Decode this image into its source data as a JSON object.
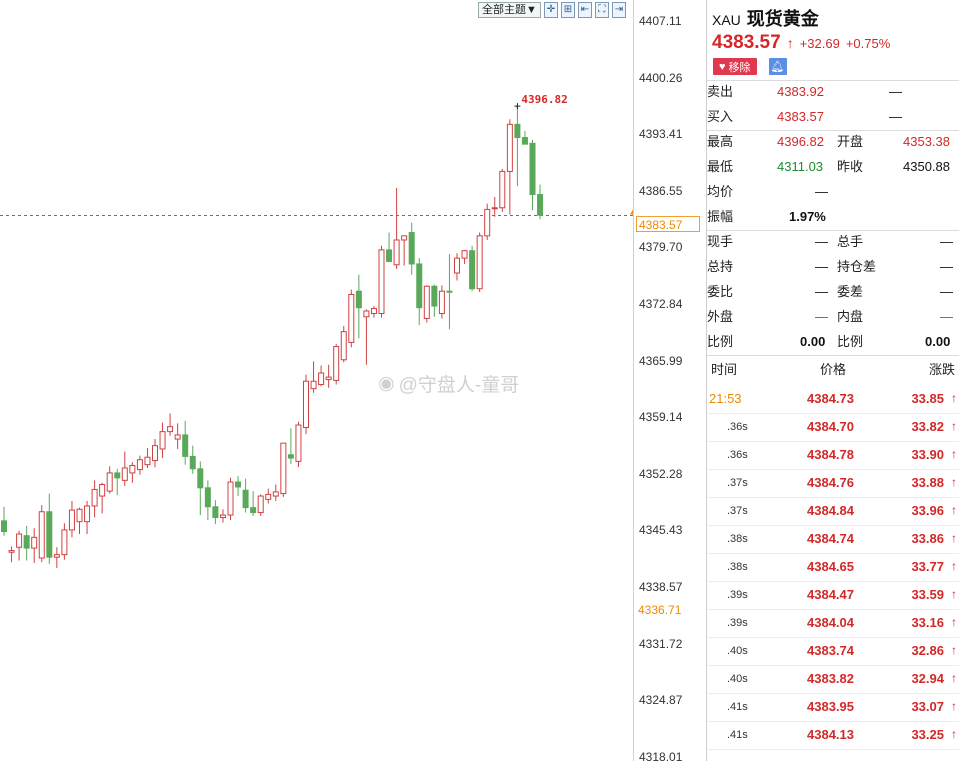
{
  "toolbar": {
    "theme_label": "全部主题▼"
  },
  "watermark": {
    "text": "@守盘人-童哥"
  },
  "axis": {
    "ticks": [
      "4407.11",
      "4400.26",
      "4393.41",
      "4386.55",
      "4379.70",
      "4372.84",
      "4365.99",
      "4359.14",
      "4352.28",
      "4345.43",
      "4338.57",
      "4331.72",
      "4324.87",
      "4318.01"
    ],
    "current_price": "4383.57",
    "low_marker": "4336.71"
  },
  "chart_data": {
    "type": "candlestick",
    "high_annotation": "4396.82",
    "current_line": 4383.57,
    "ylim": [
      4318.01,
      4407.11
    ],
    "candles": [
      {
        "o": 4346.6,
        "h": 4348.3,
        "l": 4344.8,
        "c": 4345.3
      },
      {
        "o": 4342.8,
        "h": 4343.5,
        "l": 4341.6,
        "c": 4343.0
      },
      {
        "o": 4343.4,
        "h": 4345.4,
        "l": 4341.8,
        "c": 4345.0
      },
      {
        "o": 4344.8,
        "h": 4346.0,
        "l": 4341.8,
        "c": 4343.3
      },
      {
        "o": 4343.3,
        "h": 4345.7,
        "l": 4341.5,
        "c": 4344.6
      },
      {
        "o": 4342.1,
        "h": 4348.5,
        "l": 4341.6,
        "c": 4347.7
      },
      {
        "o": 4347.7,
        "h": 4349.9,
        "l": 4341.4,
        "c": 4342.2
      },
      {
        "o": 4342.2,
        "h": 4343.4,
        "l": 4340.9,
        "c": 4342.5
      },
      {
        "o": 4342.5,
        "h": 4346.3,
        "l": 4341.9,
        "c": 4345.5
      },
      {
        "o": 4345.5,
        "h": 4349.0,
        "l": 4344.6,
        "c": 4347.9
      },
      {
        "o": 4346.5,
        "h": 4348.2,
        "l": 4345.0,
        "c": 4348.0
      },
      {
        "o": 4346.5,
        "h": 4349.0,
        "l": 4345.0,
        "c": 4348.4
      },
      {
        "o": 4348.4,
        "h": 4351.5,
        "l": 4347.0,
        "c": 4350.4
      },
      {
        "o": 4349.6,
        "h": 4351.2,
        "l": 4347.5,
        "c": 4351.0
      },
      {
        "o": 4350.2,
        "h": 4353.2,
        "l": 4349.9,
        "c": 4352.4
      },
      {
        "o": 4352.4,
        "h": 4352.9,
        "l": 4349.7,
        "c": 4351.8
      },
      {
        "o": 4351.5,
        "h": 4355.0,
        "l": 4350.8,
        "c": 4353.0
      },
      {
        "o": 4352.4,
        "h": 4353.7,
        "l": 4351.2,
        "c": 4353.3
      },
      {
        "o": 4352.8,
        "h": 4354.5,
        "l": 4352.2,
        "c": 4354.0
      },
      {
        "o": 4353.4,
        "h": 4355.4,
        "l": 4353.0,
        "c": 4354.3
      },
      {
        "o": 4353.9,
        "h": 4356.5,
        "l": 4353.1,
        "c": 4355.7
      },
      {
        "o": 4355.3,
        "h": 4358.5,
        "l": 4354.2,
        "c": 4357.4
      },
      {
        "o": 4357.4,
        "h": 4359.6,
        "l": 4356.9,
        "c": 4358.0
      },
      {
        "o": 4356.5,
        "h": 4358.4,
        "l": 4355.3,
        "c": 4357.0
      },
      {
        "o": 4357.0,
        "h": 4358.7,
        "l": 4353.4,
        "c": 4354.4
      },
      {
        "o": 4354.4,
        "h": 4355.7,
        "l": 4352.3,
        "c": 4352.9
      },
      {
        "o": 4352.9,
        "h": 4353.8,
        "l": 4347.3,
        "c": 4350.6
      },
      {
        "o": 4350.6,
        "h": 4351.5,
        "l": 4346.7,
        "c": 4348.3
      },
      {
        "o": 4348.3,
        "h": 4349.1,
        "l": 4346.2,
        "c": 4347.0
      },
      {
        "o": 4347.0,
        "h": 4348.0,
        "l": 4346.4,
        "c": 4347.3
      },
      {
        "o": 4347.3,
        "h": 4351.8,
        "l": 4346.7,
        "c": 4351.3
      },
      {
        "o": 4351.3,
        "h": 4352.0,
        "l": 4349.6,
        "c": 4350.7
      },
      {
        "o": 4350.3,
        "h": 4351.7,
        "l": 4347.6,
        "c": 4348.2
      },
      {
        "o": 4348.2,
        "h": 4350.2,
        "l": 4347.2,
        "c": 4347.6
      },
      {
        "o": 4347.6,
        "h": 4349.8,
        "l": 4347.2,
        "c": 4349.6
      },
      {
        "o": 4349.2,
        "h": 4350.5,
        "l": 4348.7,
        "c": 4349.8
      },
      {
        "o": 4349.6,
        "h": 4351.0,
        "l": 4349.0,
        "c": 4350.1
      },
      {
        "o": 4349.9,
        "h": 4352.6,
        "l": 4349.5,
        "c": 4356.0
      },
      {
        "o": 4354.6,
        "h": 4357.8,
        "l": 4353.5,
        "c": 4354.2
      },
      {
        "o": 4353.8,
        "h": 4358.6,
        "l": 4353.1,
        "c": 4358.2
      },
      {
        "o": 4357.9,
        "h": 4364.3,
        "l": 4357.1,
        "c": 4363.5
      },
      {
        "o": 4362.6,
        "h": 4365.9,
        "l": 4362.1,
        "c": 4363.5
      },
      {
        "o": 4363.1,
        "h": 4365.4,
        "l": 4362.9,
        "c": 4364.5
      },
      {
        "o": 4363.7,
        "h": 4365.5,
        "l": 4362.7,
        "c": 4364.0
      },
      {
        "o": 4363.6,
        "h": 4368.0,
        "l": 4363.1,
        "c": 4367.7
      },
      {
        "o": 4366.1,
        "h": 4370.2,
        "l": 4365.8,
        "c": 4369.5
      },
      {
        "o": 4368.2,
        "h": 4374.6,
        "l": 4367.6,
        "c": 4374.0
      },
      {
        "o": 4374.4,
        "h": 4376.4,
        "l": 4368.7,
        "c": 4372.4
      },
      {
        "o": 4371.3,
        "h": 4372.2,
        "l": 4365.5,
        "c": 4372.0
      },
      {
        "o": 4371.7,
        "h": 4372.6,
        "l": 4371.2,
        "c": 4372.3
      },
      {
        "o": 4371.7,
        "h": 4379.9,
        "l": 4371.2,
        "c": 4379.4
      },
      {
        "o": 4379.4,
        "h": 4381.5,
        "l": 4378.6,
        "c": 4378.0
      },
      {
        "o": 4377.6,
        "h": 4386.9,
        "l": 4377.1,
        "c": 4380.6
      },
      {
        "o": 4380.6,
        "h": 4381.1,
        "l": 4377.5,
        "c": 4381.1
      },
      {
        "o": 4381.5,
        "h": 4382.7,
        "l": 4376.4,
        "c": 4377.7
      },
      {
        "o": 4377.7,
        "h": 4378.4,
        "l": 4370.3,
        "c": 4372.4
      },
      {
        "o": 4371.1,
        "h": 4375.1,
        "l": 4370.6,
        "c": 4375.0
      },
      {
        "o": 4375.0,
        "h": 4375.2,
        "l": 4371.3,
        "c": 4372.6
      },
      {
        "o": 4371.7,
        "h": 4375.1,
        "l": 4371.1,
        "c": 4374.4
      },
      {
        "o": 4374.4,
        "h": 4378.9,
        "l": 4369.8,
        "c": 4374.3
      },
      {
        "o": 4376.6,
        "h": 4379.0,
        "l": 4375.7,
        "c": 4378.4
      },
      {
        "o": 4378.4,
        "h": 4379.4,
        "l": 4377.7,
        "c": 4379.3
      },
      {
        "o": 4379.3,
        "h": 4379.9,
        "l": 4374.4,
        "c": 4374.7
      },
      {
        "o": 4374.7,
        "h": 4381.5,
        "l": 4374.3,
        "c": 4381.1
      },
      {
        "o": 4381.1,
        "h": 4385.0,
        "l": 4380.6,
        "c": 4384.3
      },
      {
        "o": 4384.4,
        "h": 4385.8,
        "l": 4383.4,
        "c": 4384.5
      },
      {
        "o": 4384.5,
        "h": 4389.2,
        "l": 4384.0,
        "c": 4388.9
      },
      {
        "o": 4388.9,
        "h": 4395.2,
        "l": 4383.7,
        "c": 4394.6
      },
      {
        "o": 4394.6,
        "h": 4396.8,
        "l": 4387.1,
        "c": 4393.0
      },
      {
        "o": 4393.0,
        "h": 4393.8,
        "l": 4392.4,
        "c": 4392.2
      },
      {
        "o": 4392.3,
        "h": 4392.7,
        "l": 4384.2,
        "c": 4386.1
      },
      {
        "o": 4386.1,
        "h": 4387.3,
        "l": 4383.1,
        "c": 4383.6
      }
    ]
  },
  "panel": {
    "symbol_code": "XAU",
    "symbol_name": "现货黄金",
    "last_price": "4383.57",
    "change": "+32.69",
    "change_pct": "+0.75%",
    "remove_label": "移除",
    "rows": {
      "sell_label": "卖出",
      "sell_value": "4383.92",
      "sell_vol": "—",
      "buy_label": "买入",
      "buy_value": "4383.57",
      "buy_vol": "—",
      "high_label": "最高",
      "high_value": "4396.82",
      "open_label": "开盘",
      "open_value": "4353.38",
      "low_label": "最低",
      "low_value": "4311.03",
      "prev_label": "昨收",
      "prev_value": "4350.88",
      "avg_label": "均价",
      "avg_value": "—",
      "amp_label": "振幅",
      "amp_value": "1.97%",
      "now_hand_label": "现手",
      "now_hand_value": "—",
      "total_hand_label": "总手",
      "total_hand_value": "—",
      "hold_label": "总持",
      "hold_value": "—",
      "hold_diff_label": "持仓差",
      "hold_diff_value": "—",
      "ratio_label": "委比",
      "ratio_value": "—",
      "diff_label": "委差",
      "diff_value": "—",
      "outer_label": "外盘",
      "outer_value": "—",
      "inner_label": "内盘",
      "inner_value": "—",
      "prop1_label": "比例",
      "prop1_value": "0.00",
      "prop2_label": "比例",
      "prop2_value": "0.00"
    },
    "ticks_header": {
      "time": "时间",
      "price": "价格",
      "change": "涨跌"
    },
    "ticks": [
      {
        "time": "21:53",
        "price": "4384.73",
        "change": "33.85"
      },
      {
        "time": ".36s",
        "price": "4384.70",
        "change": "33.82"
      },
      {
        "time": ".36s",
        "price": "4384.78",
        "change": "33.90"
      },
      {
        "time": ".37s",
        "price": "4384.76",
        "change": "33.88"
      },
      {
        "time": ".37s",
        "price": "4384.84",
        "change": "33.96"
      },
      {
        "time": ".38s",
        "price": "4384.74",
        "change": "33.86"
      },
      {
        "time": ".38s",
        "price": "4384.65",
        "change": "33.77"
      },
      {
        "time": ".39s",
        "price": "4384.47",
        "change": "33.59"
      },
      {
        "time": ".39s",
        "price": "4384.04",
        "change": "33.16"
      },
      {
        "time": ".40s",
        "price": "4383.74",
        "change": "32.86"
      },
      {
        "time": ".40s",
        "price": "4383.82",
        "change": "32.94"
      },
      {
        "time": ".41s",
        "price": "4383.95",
        "change": "33.07"
      },
      {
        "time": ".41s",
        "price": "4384.13",
        "change": "33.25"
      }
    ]
  }
}
